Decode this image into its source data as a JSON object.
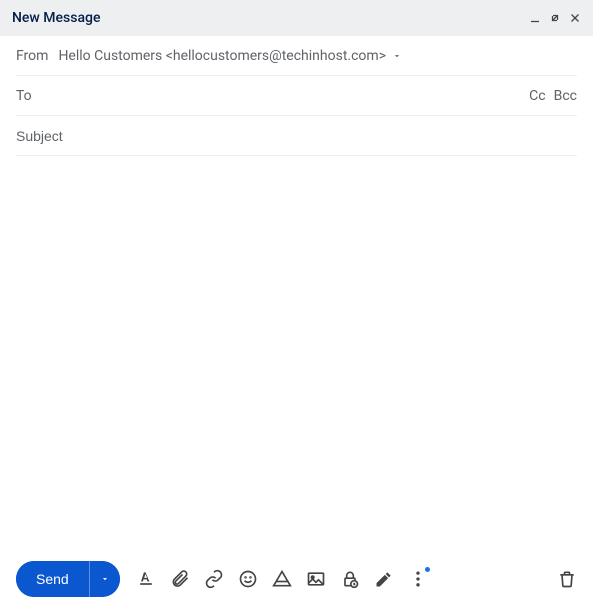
{
  "header": {
    "title": "New Message"
  },
  "from": {
    "label": "From",
    "value": "Hello Customers <hellocustomers@techinhost.com>"
  },
  "to": {
    "label": "To",
    "value": "",
    "cc_label": "Cc",
    "bcc_label": "Bcc"
  },
  "subject": {
    "placeholder": "Subject",
    "value": ""
  },
  "body": {
    "content": ""
  },
  "toolbar": {
    "send_label": "Send"
  },
  "icons": {
    "minimize": "minimize",
    "popout": "popout",
    "close": "close",
    "format": "format",
    "attach": "attach",
    "link": "link",
    "emoji": "emoji",
    "drive": "drive",
    "image": "image",
    "confidential": "confidential",
    "signature": "signature",
    "more": "more",
    "discard": "discard"
  }
}
